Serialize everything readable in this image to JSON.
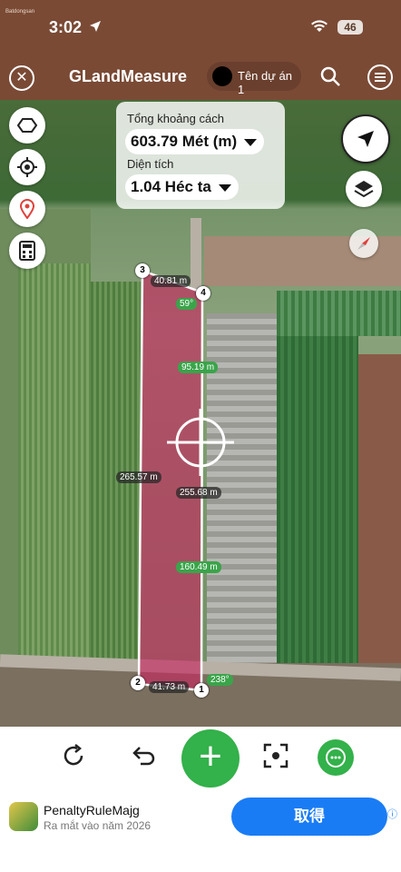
{
  "status": {
    "time": "3:02",
    "battery": "46",
    "brand": "Batdongsan"
  },
  "appbar": {
    "title": "GLandMeasure",
    "project": "Tên dự án 1"
  },
  "measure": {
    "distance_label": "Tổng khoảng cách",
    "distance_value": "603.79 Mét (m)",
    "area_label": "Diện tích",
    "area_value": "1.04 Héc ta"
  },
  "segments": {
    "top": "40.81 m",
    "right_upper": "95.19 m",
    "right_middle": "255.68 m",
    "right_lower": "160.49 m",
    "left": "265.57 m",
    "bottom": "41.73 m"
  },
  "angles": {
    "top": "59°",
    "bottom": "238°"
  },
  "vertices": [
    "1",
    "2",
    "3",
    "4"
  ],
  "ad": {
    "app_name": "PenaltyRuleMajg",
    "subtitle": "Ra mắt vào năm 2026",
    "button": "取得"
  },
  "colors": {
    "appbar": "#7a4a35",
    "accent": "#33b14a",
    "polygon": "#c0306a",
    "ad_button": "#1a7cf5"
  }
}
